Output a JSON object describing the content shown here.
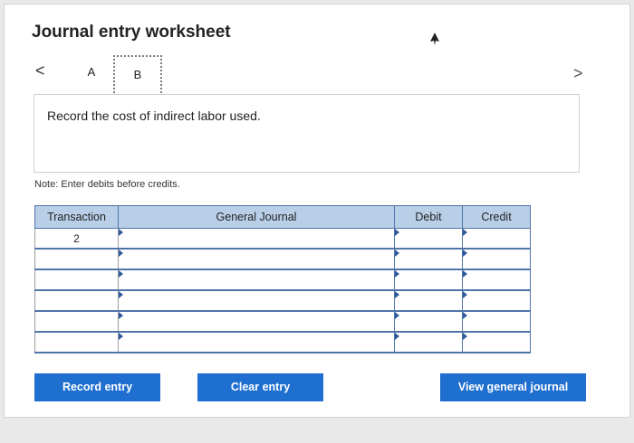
{
  "header": {
    "title": "Journal entry worksheet"
  },
  "nav": {
    "prev_glyph": "<",
    "next_glyph": ">",
    "tabs": [
      {
        "label": "A"
      },
      {
        "label": "B"
      }
    ]
  },
  "instruction": {
    "text": "Record the cost of indirect labor used."
  },
  "note": {
    "text": "Note: Enter debits before credits."
  },
  "journal_table": {
    "headers": [
      "Transaction",
      "General Journal",
      "Debit",
      "Credit"
    ],
    "rows": [
      {
        "transaction": "2",
        "general_journal": "",
        "debit": "",
        "credit": ""
      },
      {
        "transaction": "",
        "general_journal": "",
        "debit": "",
        "credit": ""
      },
      {
        "transaction": "",
        "general_journal": "",
        "debit": "",
        "credit": ""
      },
      {
        "transaction": "",
        "general_journal": "",
        "debit": "",
        "credit": ""
      },
      {
        "transaction": "",
        "general_journal": "",
        "debit": "",
        "credit": ""
      },
      {
        "transaction": "",
        "general_journal": "",
        "debit": "",
        "credit": ""
      }
    ]
  },
  "buttons": {
    "record": "Record entry",
    "clear": "Clear entry",
    "view": "View general journal"
  },
  "colors": {
    "accent": "#1f6fd0",
    "header_bg": "#b9cfe8",
    "grid": "#4f74a8"
  },
  "icons": {
    "cursor": "mouse-pointer-icon"
  }
}
